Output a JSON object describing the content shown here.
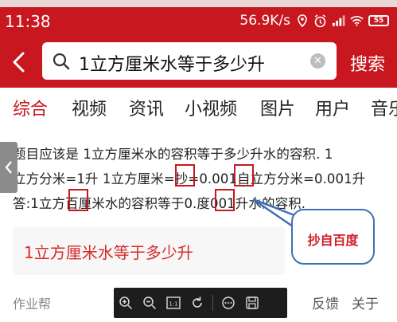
{
  "status_bar": {
    "time": "11:38",
    "network_speed": "56.9K/s",
    "battery_level": "55"
  },
  "search": {
    "query": "1立方厘米水等于多少升",
    "search_button": "搜索"
  },
  "tabs": [
    {
      "label": "综合",
      "active": true
    },
    {
      "label": "视频",
      "active": false
    },
    {
      "label": "资讯",
      "active": false
    },
    {
      "label": "小视频",
      "active": false
    },
    {
      "label": "图片",
      "active": false
    },
    {
      "label": "用户",
      "active": false
    },
    {
      "label": "音乐",
      "active": false
    }
  ],
  "answer": {
    "lines": [
      "题目应该是 1立方厘米水的容积等于多少升水的容积. 1",
      "立方分米=1升 1立方厘米=抄=0.001自立方分米=0.001升",
      "答:1立方百厘米水的容积等于0.度001升水的容积."
    ]
  },
  "callout": {
    "text": "抄自百度"
  },
  "related": {
    "text": "1立方厘米水等于多少升"
  },
  "footer": {
    "source": "作业帮",
    "feedback": "反馈",
    "about": "关于"
  },
  "viewer_toolbar": {
    "icons": [
      "zoom-in-icon",
      "zoom-out-icon",
      "actual-size-icon",
      "rotate-icon",
      "more-icon",
      "save-icon"
    ]
  },
  "colors": {
    "brand_red": "#c8171e",
    "highlight_box": "#c8171e",
    "callout_border": "#3f6fb5",
    "related_text": "#d62b2b"
  }
}
